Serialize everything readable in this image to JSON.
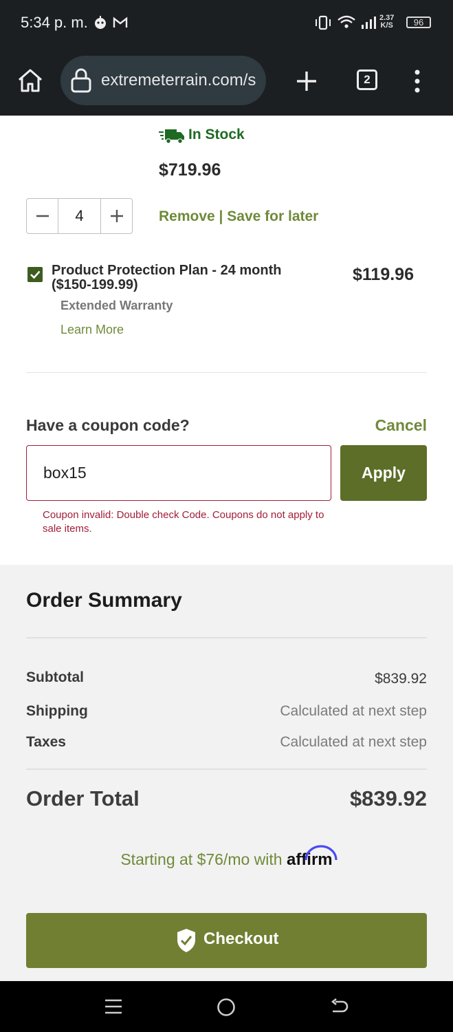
{
  "status_bar": {
    "time": "5:34 p. m.",
    "net_speed_value": "2.37",
    "net_speed_unit": "K/S",
    "battery": "96"
  },
  "browser": {
    "url": "extremeterrain.com/s",
    "tab_count": "2"
  },
  "cart_item": {
    "stock_status": "In Stock",
    "price": "$719.96",
    "quantity": "4",
    "remove_label": "Remove",
    "separator": "|",
    "save_label": "Save for later",
    "protection_plan": {
      "title_line1": "Product Protection Plan - 24 month",
      "title_line2": "($150-199.99)",
      "subtitle": "Extended Warranty",
      "learn_more": "Learn More",
      "price": "$119.96",
      "checked": true
    }
  },
  "coupon": {
    "question": "Have a coupon code?",
    "cancel_label": "Cancel",
    "input_value": "box15",
    "apply_label": "Apply",
    "error": "Coupon invalid: Double check Code. Coupons do not apply to sale items."
  },
  "order_summary": {
    "title": "Order Summary",
    "rows": [
      {
        "label": "Subtotal",
        "value": "$839.92"
      },
      {
        "label": "Shipping",
        "value": "Calculated at next step"
      },
      {
        "label": "Taxes",
        "value": "Calculated at next step"
      }
    ],
    "total_label": "Order Total",
    "total_value": "$839.92",
    "financing_text": "Starting at $76/mo with",
    "financing_brand": "affirm",
    "checkout_label": "Checkout"
  },
  "colors": {
    "olive_accent": "#6f8a3a",
    "checkout_button": "#717f33",
    "apply_button": "#5c6e27",
    "error": "#a11d36",
    "in_stock": "#1e6a23"
  }
}
